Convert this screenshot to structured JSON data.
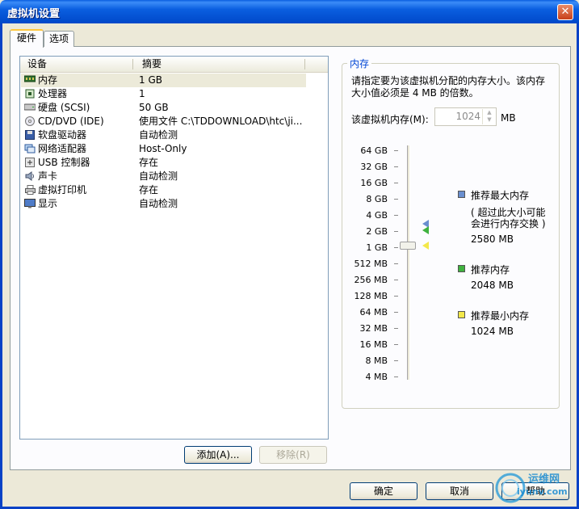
{
  "window": {
    "title": "虚拟机设置"
  },
  "tabs": [
    {
      "label": "硬件"
    },
    {
      "label": "选项"
    }
  ],
  "device_list": {
    "columns": {
      "device": "设备",
      "summary": "摘要"
    },
    "rows": [
      {
        "icon": "memory-icon",
        "name": "内存",
        "summary": "1 GB",
        "selected": true
      },
      {
        "icon": "processor-icon",
        "name": "处理器",
        "summary": "1"
      },
      {
        "icon": "hard-disk-icon",
        "name": "硬盘 (SCSI)",
        "summary": "50 GB"
      },
      {
        "icon": "cd-dvd-icon",
        "name": "CD/DVD (IDE)",
        "summary": "使用文件 C:\\TDDOWNLOAD\\htc\\ji..."
      },
      {
        "icon": "floppy-icon",
        "name": "软盘驱动器",
        "summary": "自动检测"
      },
      {
        "icon": "network-adapter-icon",
        "name": "网络适配器",
        "summary": "Host-Only"
      },
      {
        "icon": "usb-icon",
        "name": "USB 控制器",
        "summary": "存在"
      },
      {
        "icon": "sound-card-icon",
        "name": "声卡",
        "summary": "自动检测"
      },
      {
        "icon": "printer-icon",
        "name": "虚拟打印机",
        "summary": "存在"
      },
      {
        "icon": "display-icon",
        "name": "显示",
        "summary": "自动检测"
      }
    ]
  },
  "buttons": {
    "add": "添加(A)...",
    "remove": "移除(R)",
    "ok": "确定",
    "cancel": "取消",
    "help": "帮助"
  },
  "memory": {
    "group_label": "内存",
    "description_line1": "请指定要为该虚拟机分配的内存大小。该内存",
    "description_line2": "大小值必须是 4 MB 的倍数。",
    "field_label": "该虚拟机内存(M):",
    "value": "1024",
    "unit": "MB",
    "scale_ticks": [
      "64 GB",
      "32 GB",
      "16 GB",
      "8 GB",
      "4 GB",
      "2 GB",
      "1 GB",
      "512 MB",
      "256 MB",
      "128 MB",
      "64 MB",
      "32 MB",
      "16 MB",
      "8 MB",
      "4 MB"
    ],
    "slider_position": "1 GB",
    "legend": {
      "max_label": "推荐最大内存",
      "max_note_line1": "( 超过此大小可能",
      "max_note_line2": "会进行内存交换 )",
      "max_value": "2580 MB",
      "recommended_label": "推荐内存",
      "recommended_value": "2048 MB",
      "min_label": "推荐最小内存",
      "min_value": "1024 MB"
    },
    "colors": {
      "max": "#6a8fcf",
      "recommended": "#3fb23f",
      "min": "#f3e84a"
    }
  },
  "watermark": {
    "text_cn": "运维网",
    "text_en": "iyunv.com"
  }
}
